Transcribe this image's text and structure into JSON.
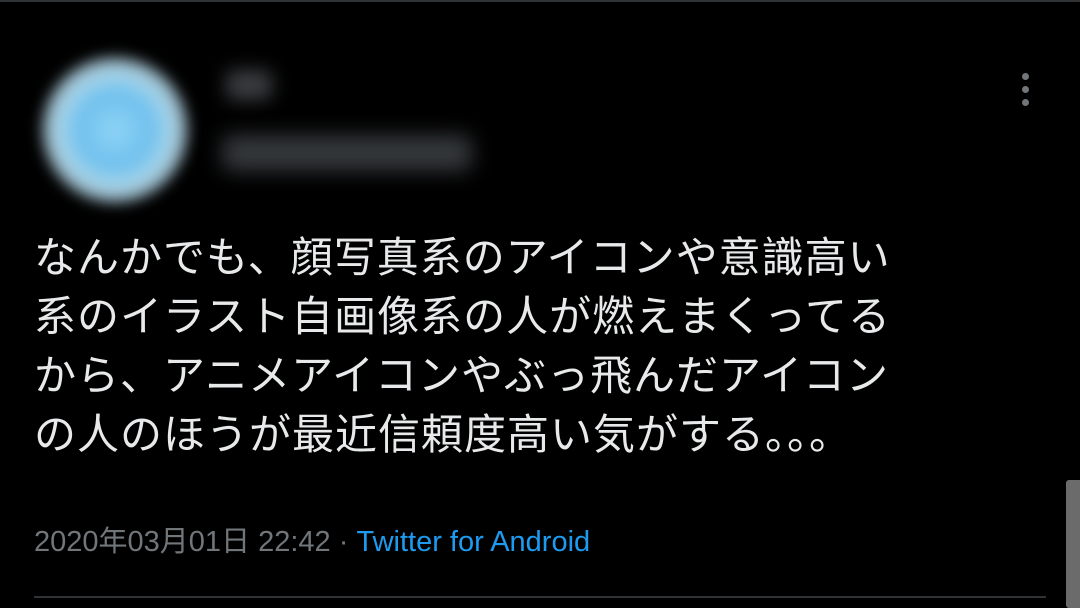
{
  "tweet": {
    "text_lines": [
      "なんかでも、顔写真系のアイコンや意識高い",
      "系のイラスト自画像系の人が燃えまくってる",
      "から、アニメアイコンやぶっ飛んだアイコン",
      "の人のほうが最近信頼度高い気がする。。。"
    ],
    "timestamp": "2020年03月01日 22:42",
    "separator": "·",
    "source": "Twitter for Android"
  },
  "icons": {
    "more": "more-vertical-icon"
  },
  "colors": {
    "background": "#000000",
    "text": "#e7e9ea",
    "muted": "#71767b",
    "link": "#1d9bf0"
  }
}
